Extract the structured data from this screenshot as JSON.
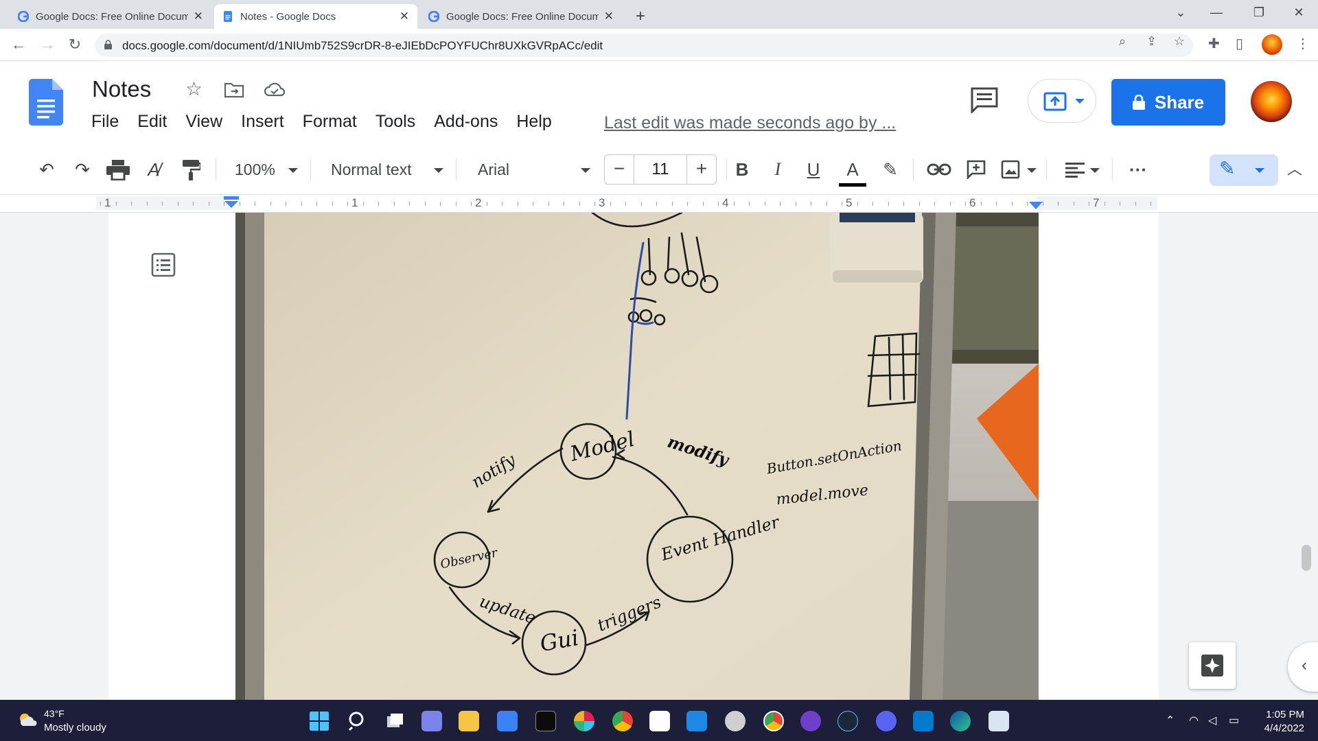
{
  "browser": {
    "tabs": [
      {
        "label": "Google Docs: Free Online Docum",
        "active": false
      },
      {
        "label": "Notes - Google Docs",
        "active": true
      },
      {
        "label": "Google Docs: Free Online Docum",
        "active": false
      }
    ],
    "url": "docs.google.com/document/d/1NIUmb752S9crDR-8-eJIEbDcPOYFUChr8UXkGVRpACc/edit"
  },
  "docs": {
    "title": "Notes",
    "menu": [
      "File",
      "Edit",
      "View",
      "Insert",
      "Format",
      "Tools",
      "Add-ons",
      "Help"
    ],
    "last_edit": "Last edit was made seconds ago by ...",
    "share_label": "Share"
  },
  "toolbar": {
    "zoom": "100%",
    "style": "Normal text",
    "font": "Arial",
    "font_size": "11"
  },
  "ruler": {
    "numbers": [
      "1",
      "1",
      "2",
      "3",
      "4",
      "5",
      "6",
      "7"
    ]
  },
  "whiteboard": {
    "labels": [
      "Model",
      "Observer",
      "Gui",
      "Event Handler",
      "notify",
      "modify",
      "update",
      "triggers",
      "Button.setOnAction",
      "model.move"
    ]
  },
  "taskbar": {
    "temperature": "43°F",
    "weather": "Mostly cloudy",
    "time": "1:05 PM",
    "date": "4/4/2022"
  },
  "colors": {
    "accent": "#1a73e8",
    "taskbar": "#1c1e3a"
  }
}
